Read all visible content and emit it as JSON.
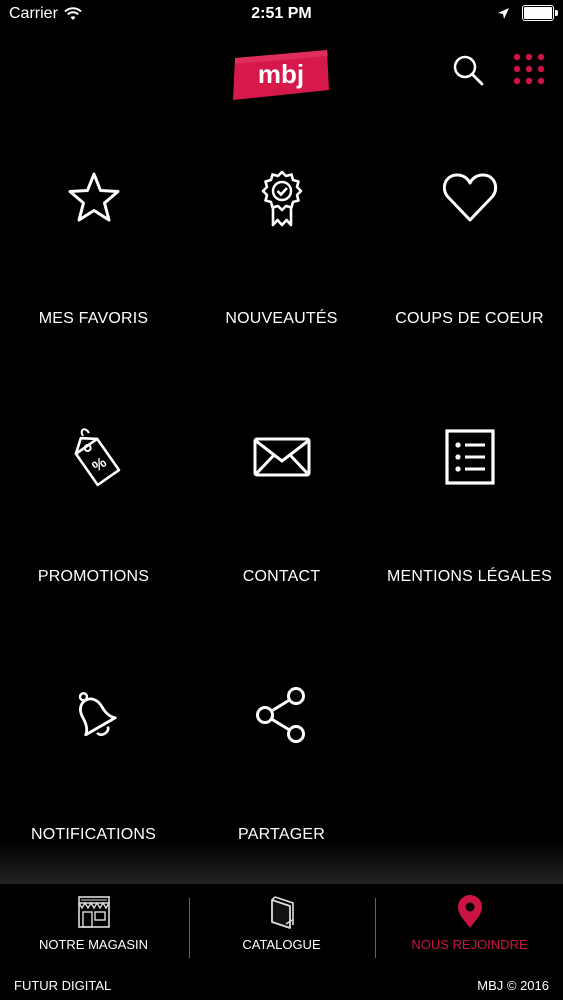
{
  "status_bar": {
    "carrier": "Carrier",
    "time": "2:51 PM"
  },
  "header": {
    "logo_text": "mbj",
    "logo_color": "#d6184a",
    "search_icon": "search-icon",
    "menu_icon": "grid-dots-icon"
  },
  "menu": {
    "items": [
      {
        "label": "MES FAVORIS",
        "icon": "star-icon"
      },
      {
        "label": "NOUVEAUTÉS",
        "icon": "award-badge-icon"
      },
      {
        "label": "COUPS DE COEUR",
        "icon": "heart-icon"
      },
      {
        "label": "PROMOTIONS",
        "icon": "percent-tag-icon"
      },
      {
        "label": "CONTACT",
        "icon": "envelope-icon"
      },
      {
        "label": "MENTIONS LÉGALES",
        "icon": "list-document-icon"
      },
      {
        "label": "NOTIFICATIONS",
        "icon": "bell-icon"
      },
      {
        "label": "PARTAGER",
        "icon": "share-icon"
      }
    ]
  },
  "bottom_nav": {
    "items": [
      {
        "label": "NOTRE MAGASIN",
        "icon": "storefront-icon"
      },
      {
        "label": "CATALOGUE",
        "icon": "catalogue-icon"
      },
      {
        "label": "NOUS REJOINDRE",
        "icon": "map-pin-icon"
      }
    ],
    "accent_color": "#cc1444"
  },
  "footer": {
    "left": "FUTUR DIGITAL",
    "right": "MBJ © 2016"
  }
}
